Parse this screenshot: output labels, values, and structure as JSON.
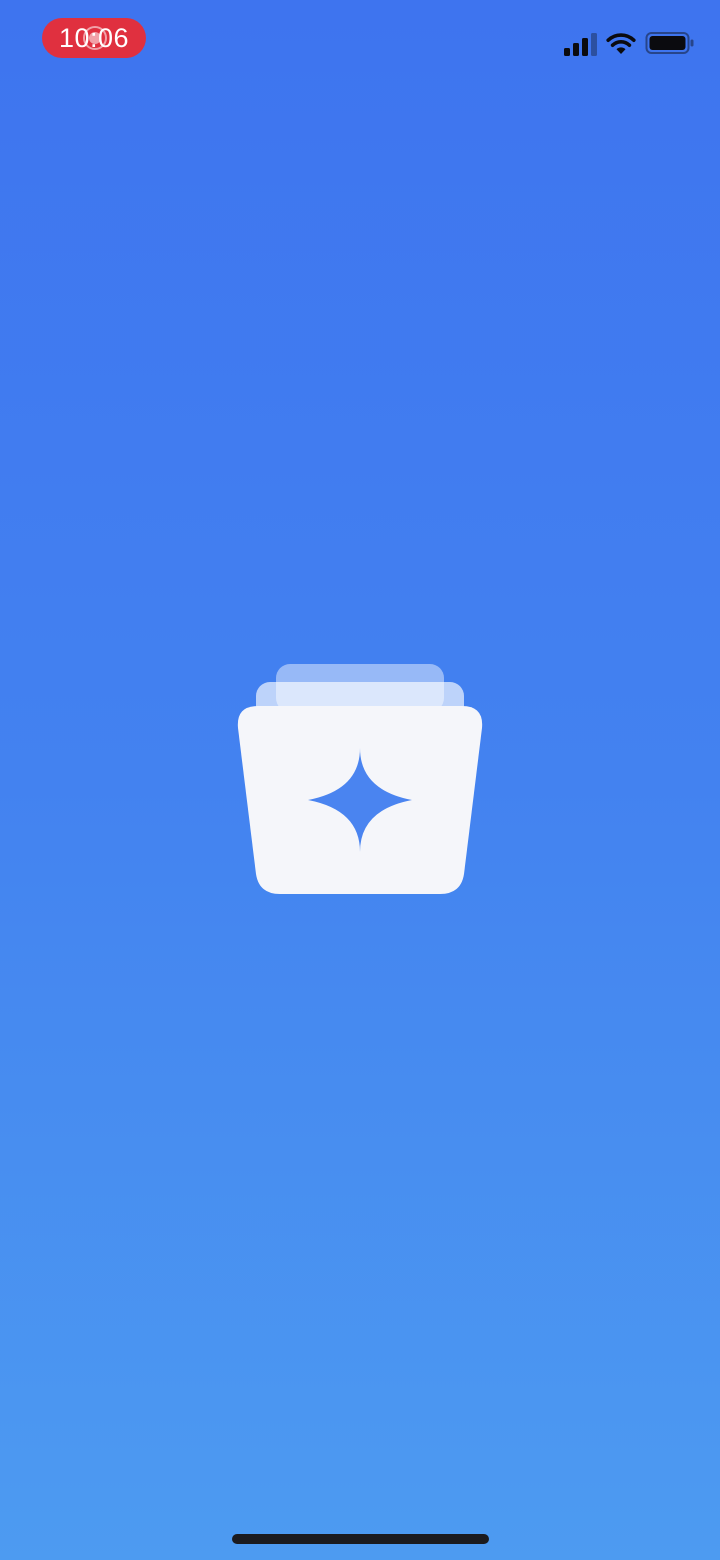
{
  "status_bar": {
    "time": "10:06",
    "recording_icon": "screen-recording-icon",
    "signal_icon": "cellular-signal-icon",
    "wifi_icon": "wifi-icon",
    "battery_icon": "battery-full-icon"
  },
  "splash": {
    "logo_icon": "stacked-cards-sparkle-icon"
  },
  "colors": {
    "background_top": "#3e74ef",
    "background_bottom": "#4d9bf1",
    "recording_pill": "#e0303f",
    "logo_fill": "#f5f6fa",
    "home_indicator": "#1b1b1f"
  }
}
